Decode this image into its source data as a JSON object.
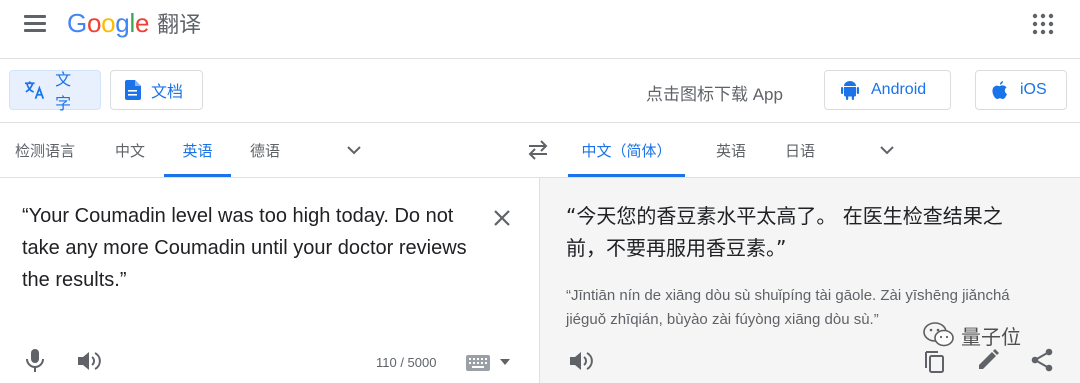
{
  "header": {
    "brand_google": [
      "G",
      "o",
      "o",
      "g",
      "l",
      "e"
    ],
    "product": "翻译"
  },
  "modes": {
    "text_label": "文字",
    "doc_label": "文档"
  },
  "promo": {
    "text": "点击图标下载 App",
    "android_label": "Android",
    "ios_label": "iOS"
  },
  "source_langs": {
    "items": [
      "检测语言",
      "中文",
      "英语",
      "德语"
    ],
    "active_index": 2
  },
  "target_langs": {
    "items": [
      "中文（简体）",
      "英语",
      "日语"
    ],
    "active_index": 0
  },
  "source": {
    "text": "“Your Coumadin level was too high today. Do not take any more Coumadin until your doctor reviews the results.”",
    "char_count": "110 / 5000"
  },
  "target": {
    "text": "“今天您的香豆素水平太高了。 在医生检查结果之前，不要再服用香豆素。”",
    "transliteration": "“Jīntiān nín de xiāng dòu sù shuǐpíng tài gāole. Zài yīshēng jiǎnchá jiéguǒ zhīqián, bùyào zài fúyòng xiāng dòu sù.”"
  },
  "watermark": {
    "text": "量子位"
  },
  "colors": {
    "accent": "#1a73e8",
    "target_bg": "#f5f5f5"
  }
}
